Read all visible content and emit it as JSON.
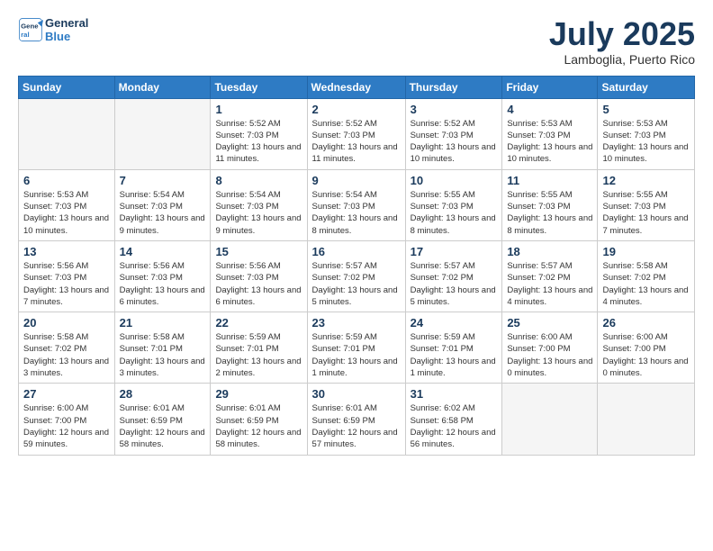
{
  "header": {
    "logo_line1": "General",
    "logo_line2": "Blue",
    "month": "July 2025",
    "location": "Lamboglia, Puerto Rico"
  },
  "weekdays": [
    "Sunday",
    "Monday",
    "Tuesday",
    "Wednesday",
    "Thursday",
    "Friday",
    "Saturday"
  ],
  "weeks": [
    [
      {
        "day": "",
        "info": ""
      },
      {
        "day": "",
        "info": ""
      },
      {
        "day": "1",
        "sunrise": "5:52 AM",
        "sunset": "7:03 PM",
        "daylight": "13 hours and 11 minutes."
      },
      {
        "day": "2",
        "sunrise": "5:52 AM",
        "sunset": "7:03 PM",
        "daylight": "13 hours and 11 minutes."
      },
      {
        "day": "3",
        "sunrise": "5:52 AM",
        "sunset": "7:03 PM",
        "daylight": "13 hours and 10 minutes."
      },
      {
        "day": "4",
        "sunrise": "5:53 AM",
        "sunset": "7:03 PM",
        "daylight": "13 hours and 10 minutes."
      },
      {
        "day": "5",
        "sunrise": "5:53 AM",
        "sunset": "7:03 PM",
        "daylight": "13 hours and 10 minutes."
      }
    ],
    [
      {
        "day": "6",
        "sunrise": "5:53 AM",
        "sunset": "7:03 PM",
        "daylight": "13 hours and 10 minutes."
      },
      {
        "day": "7",
        "sunrise": "5:54 AM",
        "sunset": "7:03 PM",
        "daylight": "13 hours and 9 minutes."
      },
      {
        "day": "8",
        "sunrise": "5:54 AM",
        "sunset": "7:03 PM",
        "daylight": "13 hours and 9 minutes."
      },
      {
        "day": "9",
        "sunrise": "5:54 AM",
        "sunset": "7:03 PM",
        "daylight": "13 hours and 8 minutes."
      },
      {
        "day": "10",
        "sunrise": "5:55 AM",
        "sunset": "7:03 PM",
        "daylight": "13 hours and 8 minutes."
      },
      {
        "day": "11",
        "sunrise": "5:55 AM",
        "sunset": "7:03 PM",
        "daylight": "13 hours and 8 minutes."
      },
      {
        "day": "12",
        "sunrise": "5:55 AM",
        "sunset": "7:03 PM",
        "daylight": "13 hours and 7 minutes."
      }
    ],
    [
      {
        "day": "13",
        "sunrise": "5:56 AM",
        "sunset": "7:03 PM",
        "daylight": "13 hours and 7 minutes."
      },
      {
        "day": "14",
        "sunrise": "5:56 AM",
        "sunset": "7:03 PM",
        "daylight": "13 hours and 6 minutes."
      },
      {
        "day": "15",
        "sunrise": "5:56 AM",
        "sunset": "7:03 PM",
        "daylight": "13 hours and 6 minutes."
      },
      {
        "day": "16",
        "sunrise": "5:57 AM",
        "sunset": "7:02 PM",
        "daylight": "13 hours and 5 minutes."
      },
      {
        "day": "17",
        "sunrise": "5:57 AM",
        "sunset": "7:02 PM",
        "daylight": "13 hours and 5 minutes."
      },
      {
        "day": "18",
        "sunrise": "5:57 AM",
        "sunset": "7:02 PM",
        "daylight": "13 hours and 4 minutes."
      },
      {
        "day": "19",
        "sunrise": "5:58 AM",
        "sunset": "7:02 PM",
        "daylight": "13 hours and 4 minutes."
      }
    ],
    [
      {
        "day": "20",
        "sunrise": "5:58 AM",
        "sunset": "7:02 PM",
        "daylight": "13 hours and 3 minutes."
      },
      {
        "day": "21",
        "sunrise": "5:58 AM",
        "sunset": "7:01 PM",
        "daylight": "13 hours and 3 minutes."
      },
      {
        "day": "22",
        "sunrise": "5:59 AM",
        "sunset": "7:01 PM",
        "daylight": "13 hours and 2 minutes."
      },
      {
        "day": "23",
        "sunrise": "5:59 AM",
        "sunset": "7:01 PM",
        "daylight": "13 hours and 1 minute."
      },
      {
        "day": "24",
        "sunrise": "5:59 AM",
        "sunset": "7:01 PM",
        "daylight": "13 hours and 1 minute."
      },
      {
        "day": "25",
        "sunrise": "6:00 AM",
        "sunset": "7:00 PM",
        "daylight": "13 hours and 0 minutes."
      },
      {
        "day": "26",
        "sunrise": "6:00 AM",
        "sunset": "7:00 PM",
        "daylight": "13 hours and 0 minutes."
      }
    ],
    [
      {
        "day": "27",
        "sunrise": "6:00 AM",
        "sunset": "7:00 PM",
        "daylight": "12 hours and 59 minutes."
      },
      {
        "day": "28",
        "sunrise": "6:01 AM",
        "sunset": "6:59 PM",
        "daylight": "12 hours and 58 minutes."
      },
      {
        "day": "29",
        "sunrise": "6:01 AM",
        "sunset": "6:59 PM",
        "daylight": "12 hours and 58 minutes."
      },
      {
        "day": "30",
        "sunrise": "6:01 AM",
        "sunset": "6:59 PM",
        "daylight": "12 hours and 57 minutes."
      },
      {
        "day": "31",
        "sunrise": "6:02 AM",
        "sunset": "6:58 PM",
        "daylight": "12 hours and 56 minutes."
      },
      {
        "day": "",
        "info": ""
      },
      {
        "day": "",
        "info": ""
      }
    ]
  ]
}
